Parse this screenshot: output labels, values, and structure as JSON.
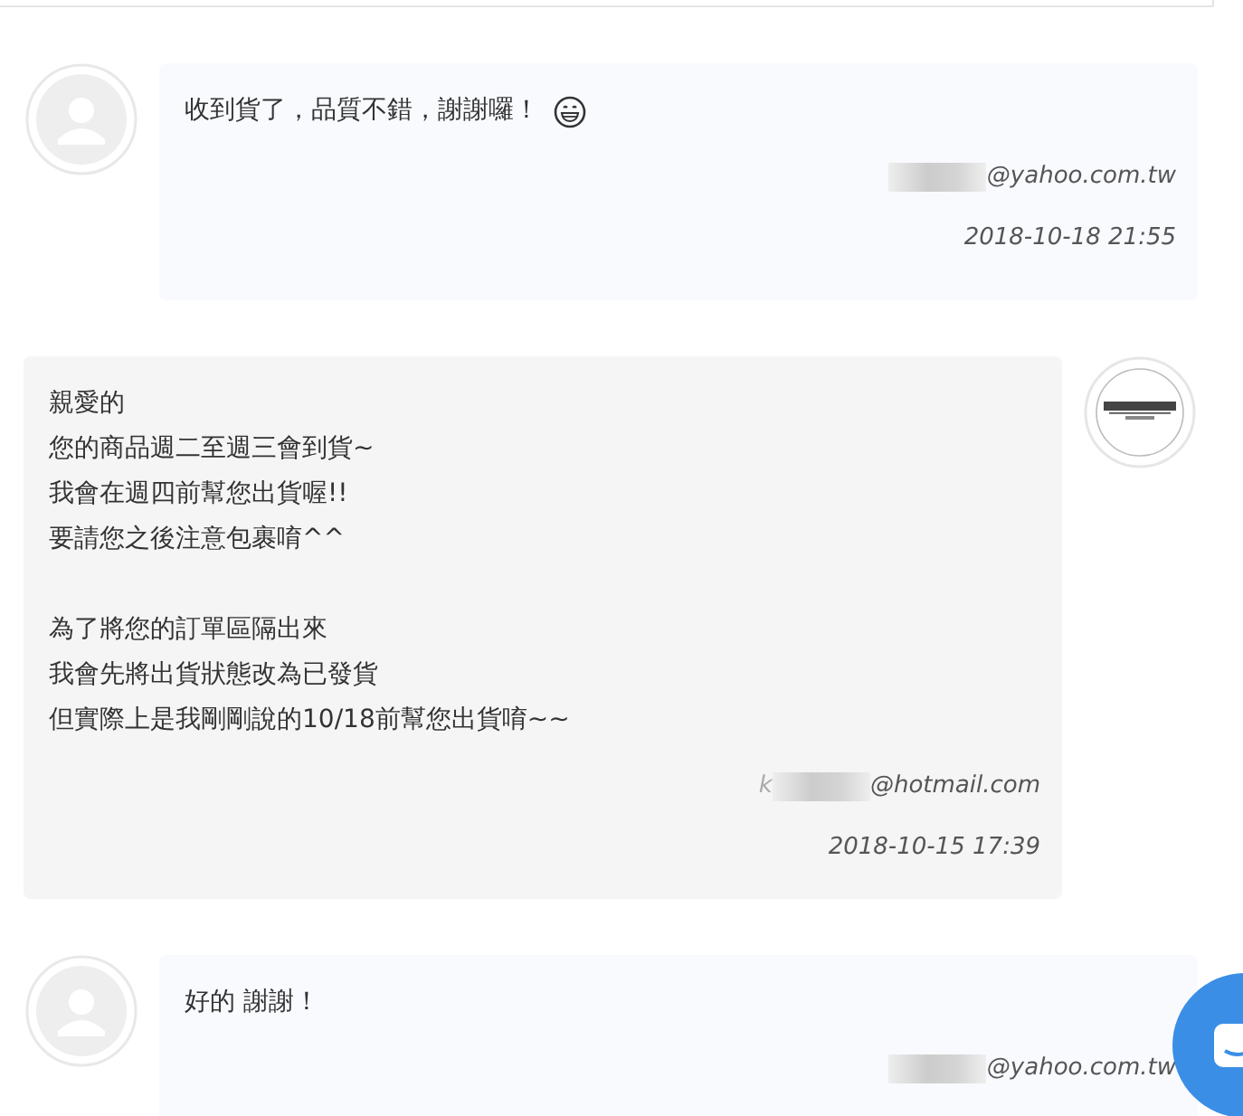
{
  "messages": [
    {
      "kind": "customer",
      "paragraphs": [
        [
          "收到貨了，品質不錯，謝謝囉！"
        ]
      ],
      "emoji": true,
      "email": {
        "domain": "@yahoo.com.tw"
      },
      "time": "2018-10-18 21:55"
    },
    {
      "kind": "seller",
      "paragraphs": [
        [
          "親愛的",
          "您的商品週二至週三會到貨~",
          "我會在週四前幫您出貨喔!!",
          "要請您之後注意包裹唷^^"
        ],
        [
          "為了將您的訂單區隔出來",
          "我會先將出貨狀態改為已發貨",
          "但實際上是我剛剛說的10/18前幫您出貨唷~~"
        ]
      ],
      "emoji": false,
      "email": {
        "visible_prefix": "k",
        "domain": "@hotmail.com"
      },
      "time": "2018-10-15 17:39"
    },
    {
      "kind": "customer",
      "paragraphs": [
        [
          "好的  謝謝！"
        ]
      ],
      "emoji": false,
      "email": {
        "domain": "@yahoo.com.tw"
      }
    }
  ]
}
